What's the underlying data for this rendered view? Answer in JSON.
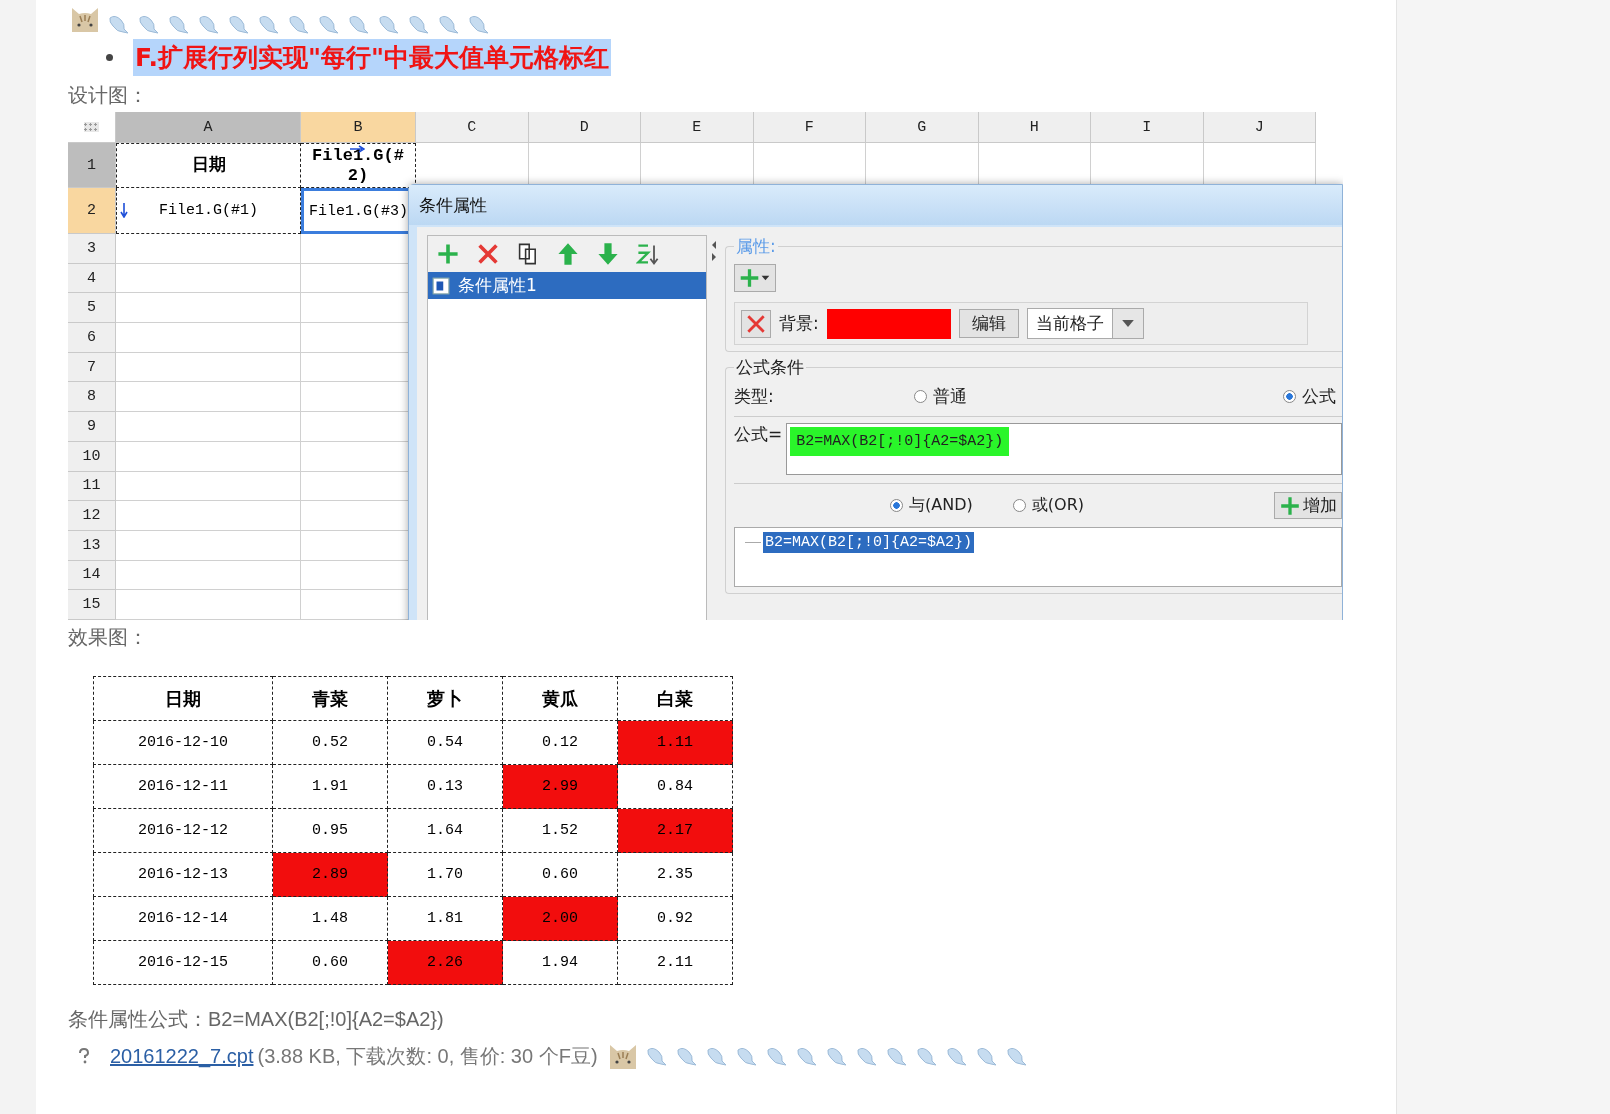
{
  "heading": "F.扩展行列实现\"每行\"中最大值单元格标红",
  "design_label": "设计图：",
  "design": {
    "columns": [
      {
        "label": "A",
        "selected": false,
        "highlighted": true
      },
      {
        "label": "B",
        "selected": true,
        "highlighted": false
      },
      {
        "label": "C",
        "selected": false,
        "highlighted": false
      },
      {
        "label": "D",
        "selected": false,
        "highlighted": false
      },
      {
        "label": "E",
        "selected": false,
        "highlighted": false
      },
      {
        "label": "F",
        "selected": false,
        "highlighted": false
      },
      {
        "label": "G",
        "selected": false,
        "highlighted": false
      },
      {
        "label": "H",
        "selected": false,
        "highlighted": false
      },
      {
        "label": "I",
        "selected": false,
        "highlighted": false
      },
      {
        "label": "J",
        "selected": false,
        "highlighted": false
      }
    ],
    "rows": [
      {
        "number": "1",
        "selected": false,
        "highlighted": true,
        "cells": [
          {
            "text": "日期",
            "kind": "header",
            "arrow_down": false,
            "arrow_right": false,
            "selected": false
          },
          {
            "text": "File1.G(#2)",
            "kind": "header",
            "arrow_down": false,
            "arrow_right": true,
            "selected": false
          }
        ]
      },
      {
        "number": "2",
        "selected": true,
        "highlighted": false,
        "cells": [
          {
            "text": "File1.G(#1)",
            "kind": "data",
            "arrow_down": true,
            "arrow_right": false,
            "selected": false
          },
          {
            "text": "File1.G(#3)",
            "kind": "data",
            "arrow_down": false,
            "arrow_right": false,
            "selected": true
          }
        ]
      },
      {
        "number": "3",
        "selected": false,
        "highlighted": false,
        "cells": []
      },
      {
        "number": "4",
        "selected": false,
        "highlighted": false,
        "cells": []
      },
      {
        "number": "5",
        "selected": false,
        "highlighted": false,
        "cells": []
      },
      {
        "number": "6",
        "selected": false,
        "highlighted": false,
        "cells": []
      },
      {
        "number": "7",
        "selected": false,
        "highlighted": false,
        "cells": []
      },
      {
        "number": "8",
        "selected": false,
        "highlighted": false,
        "cells": []
      },
      {
        "number": "9",
        "selected": false,
        "highlighted": false,
        "cells": []
      },
      {
        "number": "10",
        "selected": false,
        "highlighted": false,
        "cells": []
      },
      {
        "number": "11",
        "selected": false,
        "highlighted": false,
        "cells": []
      },
      {
        "number": "12",
        "selected": false,
        "highlighted": false,
        "cells": []
      },
      {
        "number": "13",
        "selected": false,
        "highlighted": false,
        "cells": []
      },
      {
        "number": "14",
        "selected": false,
        "highlighted": false,
        "cells": []
      },
      {
        "number": "15",
        "selected": false,
        "highlighted": false,
        "cells": []
      }
    ]
  },
  "dialog": {
    "title": "条件属性",
    "list": [
      {
        "label": "条件属性1",
        "selected": true
      }
    ],
    "properties_legend": "属性:",
    "background_label": "背景:",
    "swatch": {
      "color": "#ff0000"
    },
    "edit_button": "编辑",
    "scope_select": "当前格子",
    "formula_legend": "公式条件",
    "type_label": "类型:",
    "type_options": [
      {
        "label": "普通",
        "selected": false
      },
      {
        "label": "公式",
        "selected": true
      }
    ],
    "formula_label": "公式=",
    "formula_value": "B2=MAX(B2[;!0]{A2=$A2})",
    "logic_options": [
      {
        "label": "与(AND)",
        "selected": true
      },
      {
        "label": "或(OR)",
        "selected": false
      }
    ],
    "add_button": "增加",
    "conditions": [
      {
        "label": "B2=MAX(B2[;!0]{A2=$A2})",
        "selected": true
      }
    ]
  },
  "result_label": "效果图：",
  "result_table": {
    "columns": [
      "日期",
      "青菜",
      "萝卜",
      "黄瓜",
      "白菜"
    ],
    "rows": [
      {
        "cells": [
          {
            "text": "2016-12-10",
            "highlighted": false
          },
          {
            "text": "0.52",
            "highlighted": false
          },
          {
            "text": "0.54",
            "highlighted": false
          },
          {
            "text": "0.12",
            "highlighted": false
          },
          {
            "text": "1.11",
            "highlighted": true
          }
        ]
      },
      {
        "cells": [
          {
            "text": "2016-12-11",
            "highlighted": false
          },
          {
            "text": "1.91",
            "highlighted": false
          },
          {
            "text": "0.13",
            "highlighted": false
          },
          {
            "text": "2.99",
            "highlighted": true
          },
          {
            "text": "0.84",
            "highlighted": false
          }
        ]
      },
      {
        "cells": [
          {
            "text": "2016-12-12",
            "highlighted": false
          },
          {
            "text": "0.95",
            "highlighted": false
          },
          {
            "text": "1.64",
            "highlighted": false
          },
          {
            "text": "1.52",
            "highlighted": false
          },
          {
            "text": "2.17",
            "highlighted": true
          }
        ]
      },
      {
        "cells": [
          {
            "text": "2016-12-13",
            "highlighted": false
          },
          {
            "text": "2.89",
            "highlighted": true
          },
          {
            "text": "1.70",
            "highlighted": false
          },
          {
            "text": "0.60",
            "highlighted": false
          },
          {
            "text": "2.35",
            "highlighted": false
          }
        ]
      },
      {
        "cells": [
          {
            "text": "2016-12-14",
            "highlighted": false
          },
          {
            "text": "1.48",
            "highlighted": false
          },
          {
            "text": "1.81",
            "highlighted": false
          },
          {
            "text": "2.00",
            "highlighted": true
          },
          {
            "text": "0.92",
            "highlighted": false
          }
        ]
      },
      {
        "cells": [
          {
            "text": "2016-12-15",
            "highlighted": false
          },
          {
            "text": "0.60",
            "highlighted": false
          },
          {
            "text": "2.26",
            "highlighted": true
          },
          {
            "text": "1.94",
            "highlighted": false
          },
          {
            "text": "2.11",
            "highlighted": false
          }
        ]
      }
    ]
  },
  "formula_note": "条件属性公式：B2=MAX(B2[;!0]{A2=$A2})",
  "attachment": {
    "link": "20161222_7.cpt",
    "info": "(3.88 KB, 下载次数: 0, 售价: 30 个F豆)"
  }
}
